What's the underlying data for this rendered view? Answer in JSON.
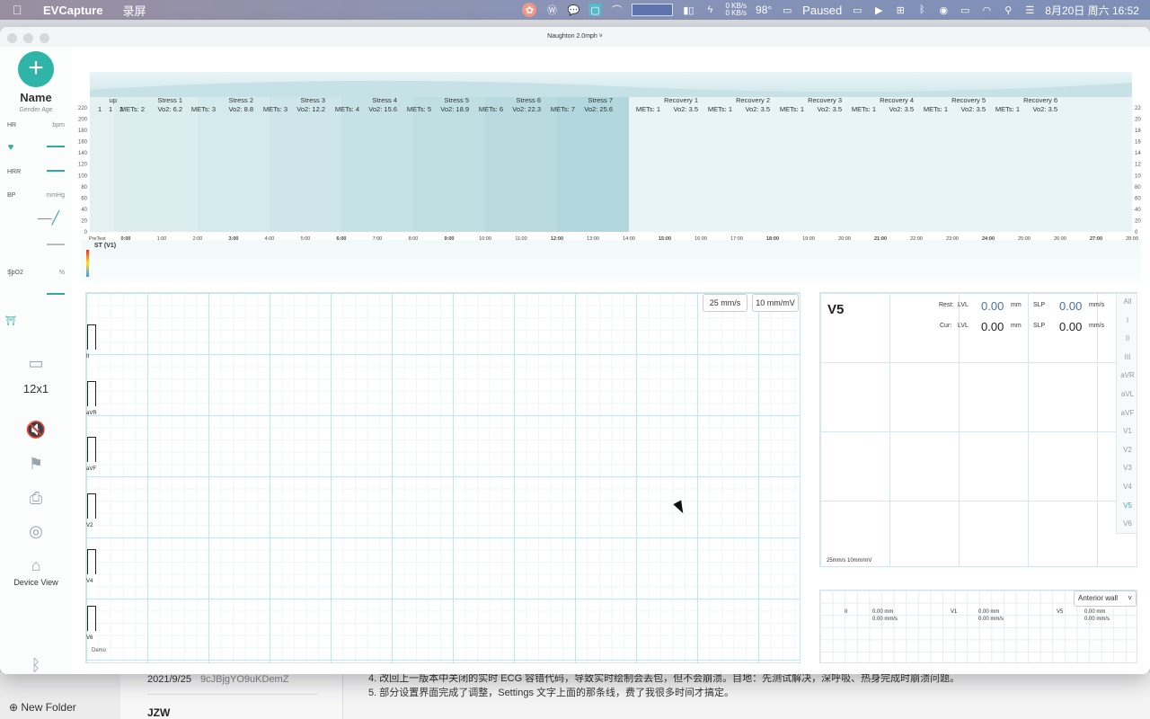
{
  "menubar": {
    "app_name": "EVCapture",
    "menu": "录屏",
    "net_up": "0 KB/s",
    "net_down": "0 KB/s",
    "temp": "98°",
    "playback": "Paused",
    "datetime": "8月20日 周六 16:52"
  },
  "window": {
    "title": "Naughton 2.0mph ˅"
  },
  "sidebar": {
    "add_label": "+",
    "name": "Name",
    "gender_age": "Gender Age",
    "hr_label": "HR",
    "hr_unit": "bpm",
    "hrr_label": "HRR",
    "bp_label": "BP",
    "bp_unit": "mmHg",
    "spo2_label": "SpO2",
    "spo2_unit": "%",
    "layout": "12x1",
    "device_view": "Device View"
  },
  "trend": {
    "stages": [
      {
        "name": "up",
        "mets": "",
        "vo2": ""
      },
      {
        "name": "Stress 1",
        "mets": "METs: 2",
        "vo2": "Vo2: 6.2"
      },
      {
        "name": "Stress 2",
        "mets": "METs: 3",
        "vo2": "Vo2: 8.8"
      },
      {
        "name": "Stress 3",
        "mets": "METs: 3",
        "vo2": "Vo2: 12.2"
      },
      {
        "name": "Stress 4",
        "mets": "METs: 4",
        "vo2": "Vo2: 15.6"
      },
      {
        "name": "Stress 5",
        "mets": "METs: 5",
        "vo2": "Vo2: 18.9"
      },
      {
        "name": "Stress 6",
        "mets": "METs: 6",
        "vo2": "Vo2: 22.3"
      },
      {
        "name": "Stress 7",
        "mets": "METs: 7",
        "vo2": "Vo2: 25.6"
      },
      {
        "name": "Recovery 1",
        "mets": "METs: 1",
        "vo2": "Vo2: 3.5"
      },
      {
        "name": "Recovery 2",
        "mets": "METs: 1",
        "vo2": "Vo2: 3.5"
      },
      {
        "name": "Recovery 3",
        "mets": "METs: 1",
        "vo2": "Vo2: 3.5"
      },
      {
        "name": "Recovery 4",
        "mets": "METs: 1",
        "vo2": "Vo2: 3.5"
      },
      {
        "name": "Recovery 5",
        "mets": "METs: 1",
        "vo2": "Vo2: 3.5"
      },
      {
        "name": "Recovery 6",
        "mets": "METs: 1",
        "vo2": "Vo2: 3.5"
      }
    ],
    "warmup_numbers": [
      "1",
      "1",
      "2"
    ],
    "y_ticks": [
      "220",
      "200",
      "180",
      "160",
      "140",
      "120",
      "100",
      "80",
      "60",
      "40",
      "20",
      "0"
    ],
    "x_ticks": [
      "PreTest",
      "0:00",
      "1:00",
      "2:00",
      "3:00",
      "4:00",
      "5:00",
      "6:00",
      "7:00",
      "8:00",
      "9:00",
      "10:00",
      "11:00",
      "12:00",
      "13:00",
      "14:00",
      "15:00",
      "16:00",
      "17:00",
      "18:00",
      "19:00",
      "20:00",
      "21:00",
      "22:00",
      "23:00",
      "24:00",
      "25:00",
      "26:00",
      "27:00",
      "28:00"
    ],
    "st_label": "ST (V1)"
  },
  "ecg": {
    "speed": "25 mm/s",
    "gain": "10 mm/mV",
    "leads": [
      "II",
      "aVR",
      "aVF",
      "V2",
      "V4",
      "V6"
    ],
    "demo": "Demo"
  },
  "st_panel": {
    "lead": "V5",
    "rest_label": "Rest:",
    "cur_label": "Cur:",
    "lvl": "LVL",
    "slp": "SLP",
    "rest_lvl": "0.00",
    "rest_slp": "0.00",
    "cur_lvl": "0.00",
    "cur_slp": "0.00",
    "mm": "mm",
    "mms": "mm/s",
    "scale": "25mm/s  10mm/mV",
    "lead_list": [
      "All",
      "I",
      "II",
      "III",
      "aVR",
      "aVL",
      "aVF",
      "V1",
      "V2",
      "V3",
      "V4",
      "V5",
      "V6"
    ],
    "active_lead": "V5"
  },
  "summary": {
    "selector": "Anterior wall",
    "items": [
      {
        "lead": "II",
        "mm": "0.00 mm",
        "mms": "0.00 mm/s"
      },
      {
        "lead": "V1",
        "mm": "0.00 mm",
        "mms": "0.00 mm/s"
      },
      {
        "lead": "V5",
        "mm": "0.00 mm",
        "mms": "0.00 mm/s"
      }
    ]
  },
  "notes_bg": {
    "new_folder": "New Folder",
    "date": "2021/9/25",
    "code": "9cJBjgYO9uKDemZ",
    "title": "JZW",
    "line4": "4. 改回上一版本中关闭的实时 ECG 容错代码，导致实时绘制会丢包，但不会崩溃。目地：先测试解决，深呼吸、热身完成时崩溃问题。",
    "line5": "5. 部分设置界面完成了调整，Settings 文字上面的那条线，费了我很多时间才搞定。"
  }
}
